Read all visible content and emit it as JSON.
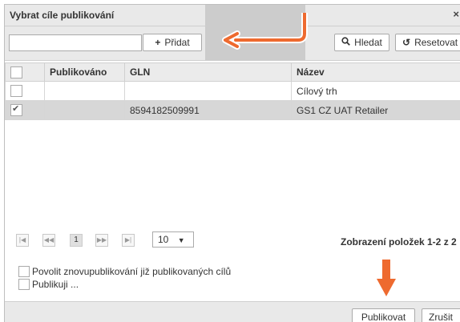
{
  "dialog": {
    "title": "Vybrat cíle publikování",
    "close_glyph": "×"
  },
  "toolbar": {
    "search_value": "",
    "add_icon": "plus-icon",
    "add_glyph": "+",
    "add_label": "Přidat",
    "search_icon": "magnifier-icon",
    "search_glyph": "🔍",
    "search_label": "Hledat",
    "reset_icon": "reset-icon",
    "reset_glyph": "↺",
    "reset_label": "Resetovat"
  },
  "table": {
    "headers": [
      "",
      "Publikováno",
      "GLN",
      "Název"
    ],
    "rows": [
      {
        "checked": false,
        "published": "",
        "gln": "",
        "name": "Cílový trh",
        "selected": false
      },
      {
        "checked": true,
        "published": "",
        "gln": "8594182509991",
        "name": "GS1 CZ UAT Retailer",
        "selected": true
      }
    ]
  },
  "pager": {
    "first": "|◀",
    "prev": "◀◀",
    "current_page": "1",
    "next": "▶▶",
    "last": "▶|",
    "page_size": "10",
    "page_size_caret": "▼",
    "summary": "Zobrazení položek 1-2 z 2"
  },
  "options": [
    {
      "label": "Povolit znovupublikování již publikovaných cílů",
      "checked": false
    },
    {
      "label": "Publikuji ...",
      "checked": false
    }
  ],
  "footer": {
    "publish_label": "Publikovat",
    "cancel_label": "Zrušit"
  },
  "colors": {
    "annotation_arrow": "#ee6a2f",
    "header_bg": "#e9e9e9",
    "selected_row": "#d7d7d7",
    "highlight_block": "#cccccc"
  }
}
